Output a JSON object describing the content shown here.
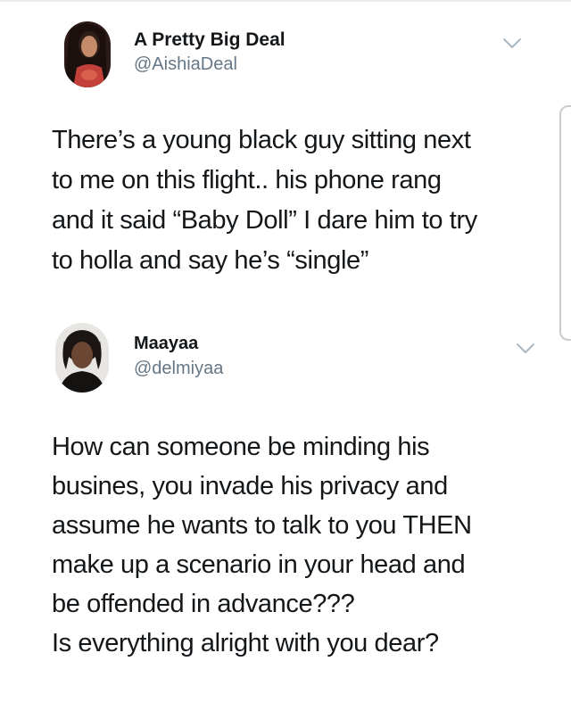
{
  "tweets": [
    {
      "author": {
        "name": "A Pretty Big Deal",
        "handle": "@AishiaDeal"
      },
      "text_lines": [
        "There’s a young black guy sitting next",
        "to me on this flight.. his phone rang",
        "and it said “Baby Doll” I dare him to try",
        "to holla and say he’s “single”"
      ]
    },
    {
      "author": {
        "name": "Maayaa",
        "handle": "@delmiyaa"
      },
      "text_lines": [
        "How can someone be minding his",
        "busines, you invade his privacy and",
        "assume he wants to talk to you THEN",
        "make up a scenario in your head and",
        "be offended in advance???",
        "Is everything alright with you dear?"
      ]
    }
  ],
  "icons": {
    "menu": "chevron-down-icon",
    "avatar": "avatar"
  },
  "colors": {
    "text": "#14171a",
    "handle": "#657786",
    "chevron": "#aab8c2"
  }
}
